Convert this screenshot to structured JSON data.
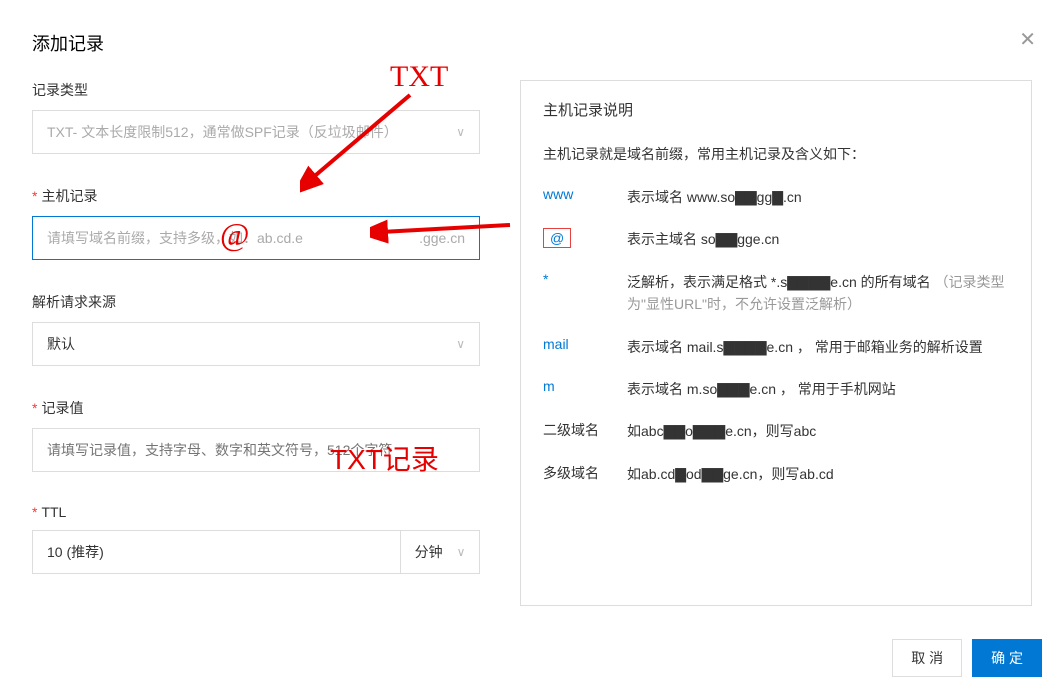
{
  "modal": {
    "title": "添加记录"
  },
  "form": {
    "recordType": {
      "label": "记录类型",
      "value": "TXT- 文本长度限制512，通常做SPF记录（反垃圾邮件）"
    },
    "host": {
      "label": "主机记录",
      "placeholder": "请填写域名前缀，支持多级，如：ab.cd.e",
      "suffix": ".gge.cn"
    },
    "source": {
      "label": "解析请求来源",
      "value": "默认"
    },
    "value": {
      "label": "记录值",
      "placeholder": "请填写记录值，支持字母、数字和英文符号，512个字符"
    },
    "ttl": {
      "label": "TTL",
      "value": "10 (推荐)",
      "unit": "分钟"
    }
  },
  "help": {
    "title": "主机记录说明",
    "desc": "主机记录就是域名前缀，常用主机记录及含义如下：",
    "rows": {
      "www": {
        "key": "www",
        "val": "表示域名 www.so▇▇gg▇.cn"
      },
      "at": {
        "key": "@",
        "val": "表示主域名 so▇▇gge.cn"
      },
      "star": {
        "key": "*",
        "val_a": "泛解析，表示满足格式 *.s▇▇▇▇e.cn 的所有域名",
        "val_b": "（记录类型为\"显性URL\"时，不允许设置泛解析）"
      },
      "mail": {
        "key": "mail",
        "val": "表示域名 mail.s▇▇▇▇e.cn ， 常用于邮箱业务的解析设置"
      },
      "m": {
        "key": "m",
        "val": "表示域名 m.so▇▇▇e.cn ， 常用于手机网站"
      },
      "sub2": {
        "key": "二级域名",
        "val": "如abc▇▇o▇▇▇e.cn，则写abc"
      },
      "subN": {
        "key": "多级域名",
        "val": "如ab.cd▇od▇▇ge.cn，则写ab.cd"
      }
    }
  },
  "footer": {
    "cancel": "取 消",
    "ok": "确 定"
  },
  "annotations": {
    "txt": "TXT",
    "at": "@",
    "txtrec": "TXT记录"
  }
}
